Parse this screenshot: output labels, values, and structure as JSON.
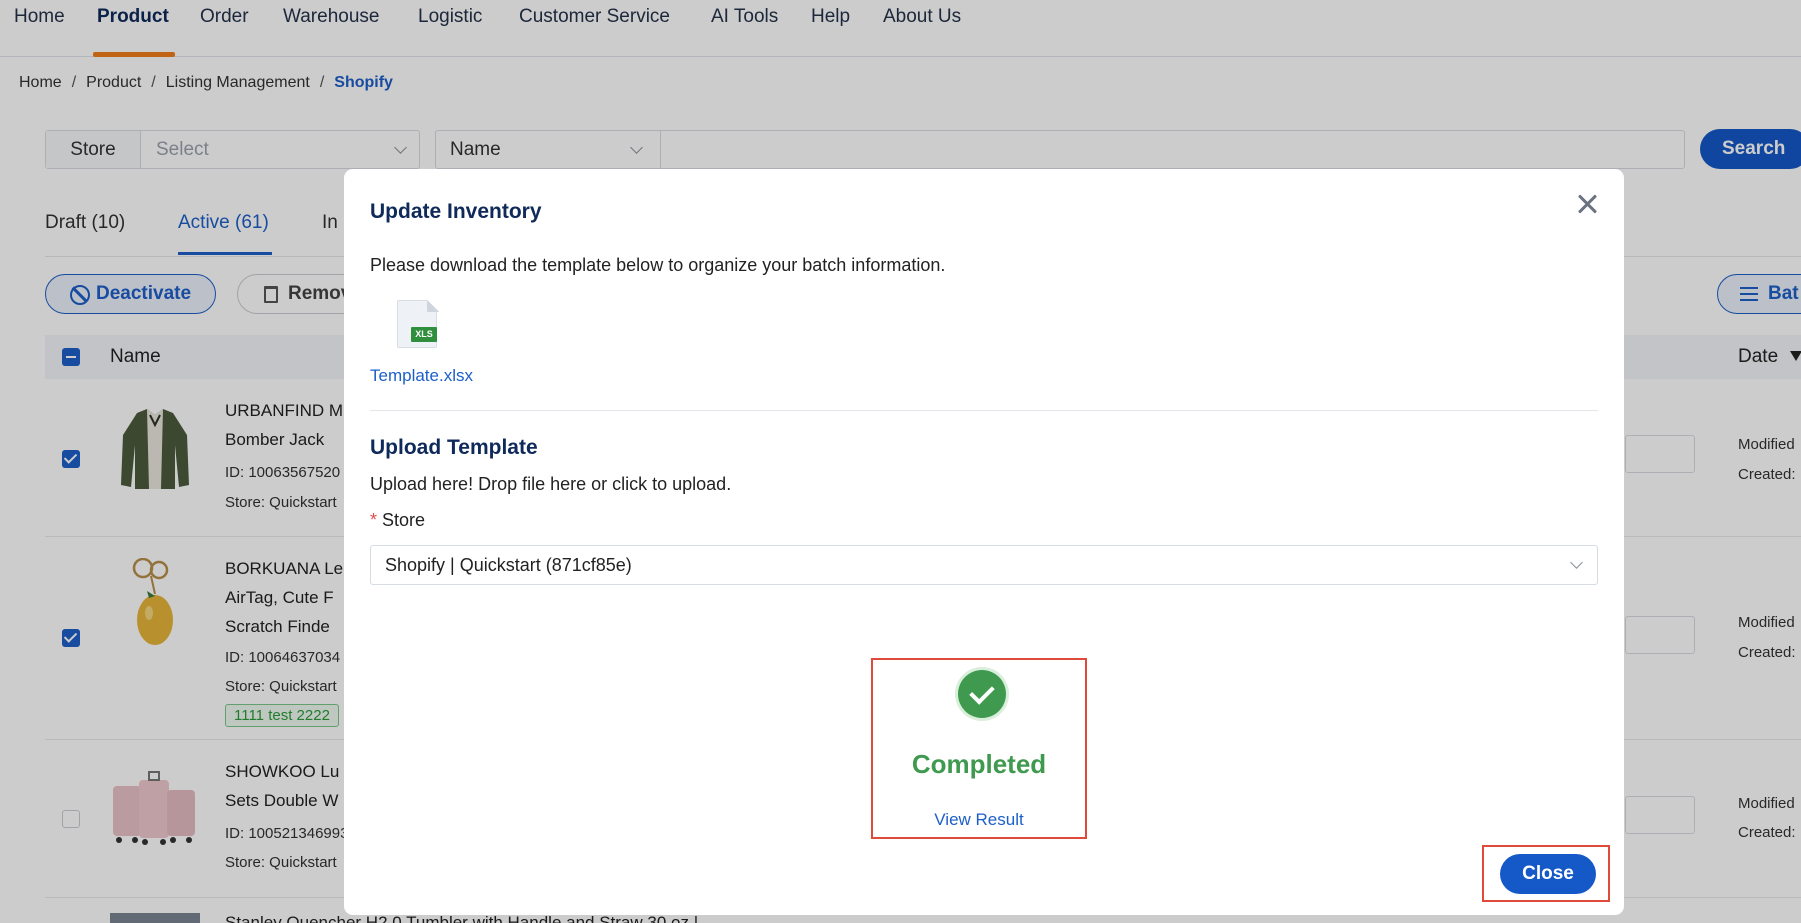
{
  "nav": {
    "items": [
      "Home",
      "Product",
      "Order",
      "Warehouse",
      "Logistic",
      "Customer Service",
      "AI Tools",
      "Help",
      "About Us"
    ],
    "active": "Product"
  },
  "breadcrumb": [
    "Home",
    "Product",
    "Listing Management",
    "Shopify"
  ],
  "filters": {
    "store_label": "Store",
    "store_placeholder": "Select",
    "name_select": "Name",
    "search_button": "Search"
  },
  "tabs": [
    "Draft (10)",
    "Active (61)",
    "In"
  ],
  "actions": {
    "deactivate": "Deactivate",
    "remove": "Remov",
    "batch": "Bat"
  },
  "table": {
    "headers": {
      "name": "Name",
      "date": "Date"
    },
    "rows": [
      {
        "title_lines": [
          "URBANFIND M",
          "Bomber Jack"
        ],
        "id": "ID: 10063567520",
        "store": "Store: Quickstart",
        "modified": "Modified",
        "created": "Created:",
        "checked": true
      },
      {
        "title_lines": [
          "BORKUANA Le",
          "AirTag, Cute F",
          "Scratch Finde"
        ],
        "id": "ID: 10064637034",
        "store": "Store: Quickstart",
        "tag": "1111 test 2222",
        "modified": "Modified",
        "created": "Created:",
        "checked": true
      },
      {
        "title_lines": [
          "SHOWKOO Lu",
          "Sets Double W"
        ],
        "id": "ID: 100521346993",
        "store": "Store: Quickstart",
        "modified": "Modified",
        "created": "Created:",
        "checked": false
      },
      {
        "title_lines": [
          "Stanley Quencher H2.0 Tumbler with Handle and Straw 30 oz |"
        ],
        "checked": false
      }
    ]
  },
  "modal": {
    "title": "Update Inventory",
    "description": "Please download the template below to organize your batch information.",
    "file_badge": "XLS",
    "template_link": "Template.xlsx",
    "upload_title": "Upload Template",
    "upload_description": "Upload here! Drop file here or click to upload.",
    "required_mark": "*",
    "store_label": "Store",
    "store_value": "Shopify | Quickstart (871cf85e)",
    "status": "Completed",
    "view_result": "View Result",
    "close_button": "Close"
  },
  "colors": {
    "primary": "#1558c7",
    "nav_active_underline": "#f07d1a",
    "success": "#3f9a4f",
    "highlight_box": "#e04a3a"
  }
}
